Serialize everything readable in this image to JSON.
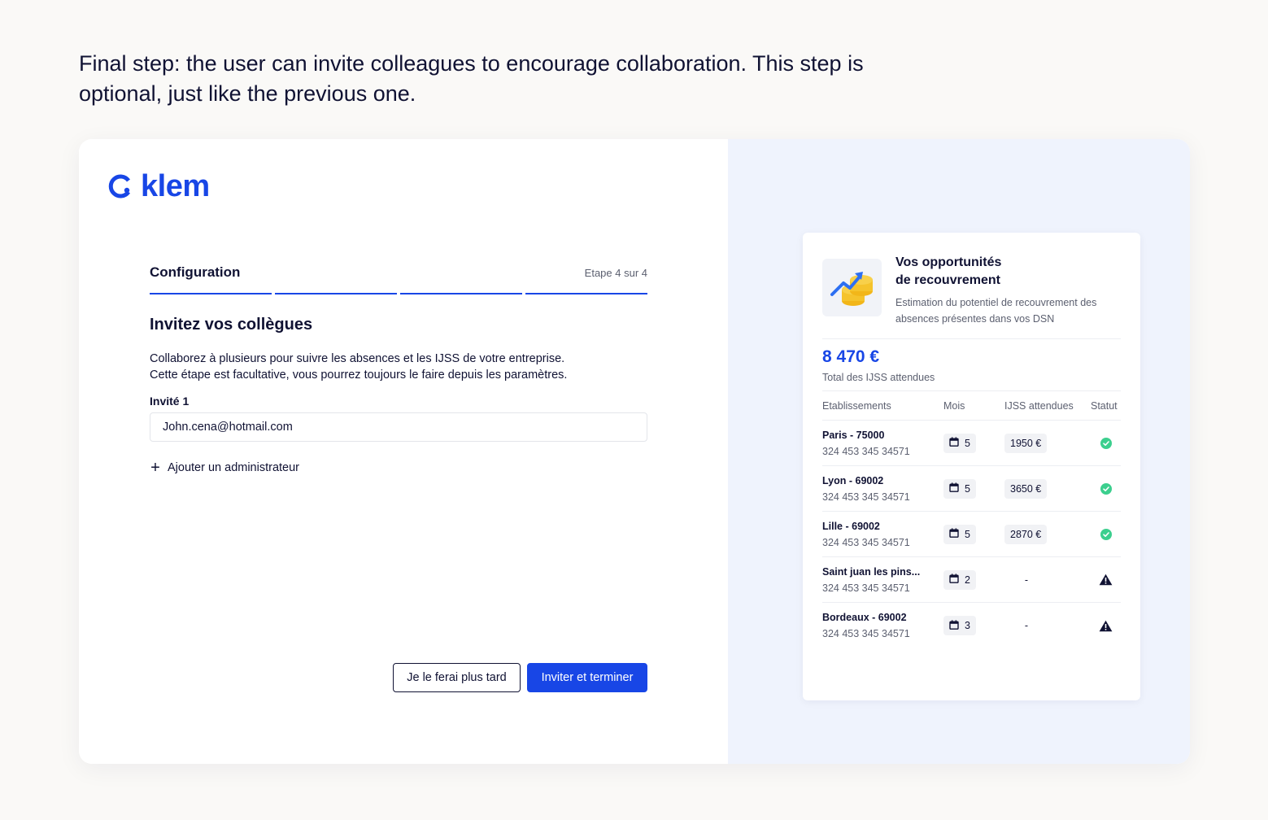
{
  "caption": "Final step: the user can invite colleagues to encourage collaboration. This step is optional, just like the previous one.",
  "brand": {
    "name": "klem",
    "color": "#1846e6"
  },
  "header": {
    "title": "Configuration",
    "step": "Etape 4 sur 4",
    "progress_steps": 4,
    "progress_completed": 4
  },
  "invite": {
    "title": "Invitez vos collègues",
    "desc_line1": "Collaborez à plusieurs pour suivre les absences et les IJSS de votre entreprise.",
    "desc_line2": "Cette étape est facultative, vous pourrez toujours le faire depuis les paramètres.",
    "field_label": "Invité 1",
    "field_value": "John.cena@hotmail.com",
    "add_admin": "Ajouter un administrateur",
    "btn_later": "Je le ferai plus tard",
    "btn_submit": "Inviter et terminer"
  },
  "panel": {
    "title_line1": "Vos opportunités",
    "title_line2": "de recouvrement",
    "subtitle": "Estimation du potentiel de recouvrement des absences présentes dans vos DSN",
    "total": "8 470 €",
    "total_label": "Total des IJSS attendues",
    "columns": [
      "Etablissements",
      "Mois",
      "IJSS attendues",
      "Statut"
    ],
    "rows": [
      {
        "name": "Paris - 75000",
        "siret": "324 453 345 34571",
        "months": "5",
        "amount": "1950 €",
        "status": "ok"
      },
      {
        "name": "Lyon - 69002",
        "siret": "324 453 345 34571",
        "months": "5",
        "amount": "3650 €",
        "status": "ok"
      },
      {
        "name": "Lille - 69002",
        "siret": "324 453 345 34571",
        "months": "5",
        "amount": "2870 €",
        "status": "ok"
      },
      {
        "name": "Saint juan les pins...",
        "siret": "324 453 345 34571",
        "months": "2",
        "amount": "-",
        "status": "warning"
      },
      {
        "name": "Bordeaux - 69002",
        "siret": "324 453 345 34571",
        "months": "3",
        "amount": "-",
        "status": "warning"
      }
    ],
    "colors": {
      "ok": "#3ccf8e",
      "warning": "#101233",
      "accent": "#1846e6"
    }
  }
}
